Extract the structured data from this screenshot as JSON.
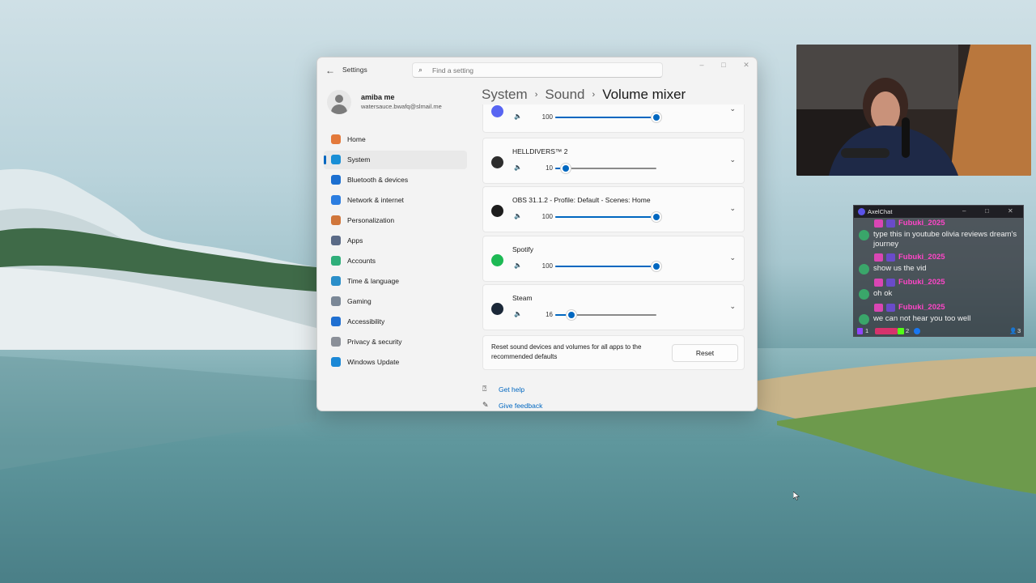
{
  "settings": {
    "app_title": "Settings",
    "back_icon": "back-arrow-icon",
    "search": {
      "placeholder": "Find a setting"
    },
    "window_controls": {
      "minimize": "–",
      "maximize": "□",
      "close": "✕"
    },
    "profile": {
      "name": "amiba me",
      "email": "watersauce.bwafq@slmail.me"
    },
    "nav": [
      {
        "label": "Home",
        "icon": "home-icon",
        "color": "#e3793b"
      },
      {
        "label": "System",
        "icon": "system-icon",
        "color": "#1a8fd6",
        "active": true
      },
      {
        "label": "Bluetooth & devices",
        "icon": "bluetooth-icon",
        "color": "#1b6fd0"
      },
      {
        "label": "Network & internet",
        "icon": "wifi-icon",
        "color": "#2b7de0"
      },
      {
        "label": "Personalization",
        "icon": "brush-icon",
        "color": "#d0763b"
      },
      {
        "label": "Apps",
        "icon": "apps-icon",
        "color": "#5a6a86"
      },
      {
        "label": "Accounts",
        "icon": "accounts-icon",
        "color": "#2fae7a"
      },
      {
        "label": "Time & language",
        "icon": "globe-clock-icon",
        "color": "#2a8ec9"
      },
      {
        "label": "Gaming",
        "icon": "gamepad-icon",
        "color": "#7a8796"
      },
      {
        "label": "Accessibility",
        "icon": "accessibility-icon",
        "color": "#1f6fd1"
      },
      {
        "label": "Privacy & security",
        "icon": "shield-icon",
        "color": "#8a8f98"
      },
      {
        "label": "Windows Update",
        "icon": "update-icon",
        "color": "#1b88d6"
      }
    ],
    "breadcrumb": {
      "level1": "System",
      "level2": "Sound",
      "current": "Volume mixer",
      "separator": "›"
    },
    "apps": [
      {
        "name": "",
        "volume": 100,
        "icon": "discord-icon",
        "icon_color": "#5865f2"
      },
      {
        "name": "HELLDIVERS™ 2",
        "volume": 10,
        "icon": "helldivers-icon",
        "icon_color": "#2d2d2d"
      },
      {
        "name": "OBS 31.1.2 - Profile: Default - Scenes: Home",
        "volume": 100,
        "icon": "obs-icon",
        "icon_color": "#1d1d1d"
      },
      {
        "name": "Spotify",
        "volume": 100,
        "icon": "spotify-icon",
        "icon_color": "#1db954"
      },
      {
        "name": "Steam",
        "volume": 16,
        "icon": "steam-icon",
        "icon_color": "#1b2838"
      }
    ],
    "speaker_icon": "🔈",
    "reset": {
      "text": "Reset sound devices and volumes for all apps to the recommended defaults",
      "button": "Reset"
    },
    "links": {
      "help": "Get help",
      "feedback": "Give feedback"
    }
  },
  "chat": {
    "title": "AxelChat",
    "messages": [
      {
        "user": "Fubuki_2025",
        "text": "type this in youtube olivia reviews dream's journey"
      },
      {
        "user": "Fubuki_2025",
        "text": "show us the vid"
      },
      {
        "user": "Fubuki_2025",
        "text": "oh ok"
      },
      {
        "user": "Fubuki_2025",
        "text": "we can not hear you too well"
      }
    ],
    "footer": {
      "twitch_count": "1",
      "kick_count": "2",
      "viewers": "3"
    }
  }
}
